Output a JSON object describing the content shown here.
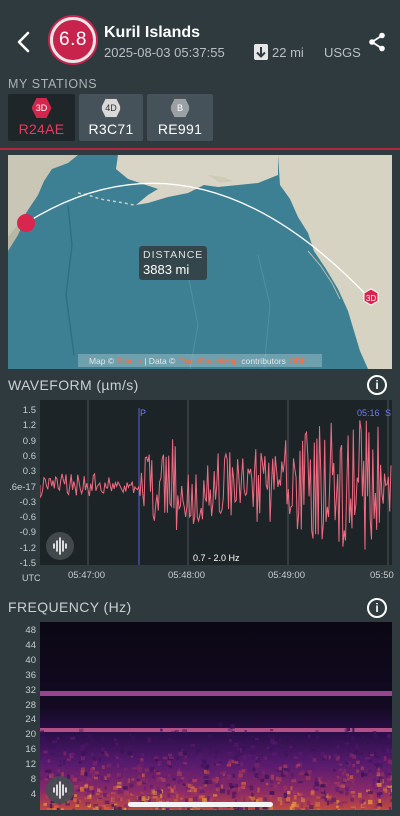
{
  "header": {
    "back_icon": "chevron-left-icon",
    "magnitude": "6.8",
    "title": "Kuril Islands",
    "datetime": "2025-08-03 05:37:55",
    "depth": "22 mi",
    "source": "USGS",
    "share_icon": "share-icon",
    "magnitude_color": "#c8234c"
  },
  "stations": {
    "label": "MY STATIONS",
    "items": [
      {
        "badge": "3D",
        "code": "R24AE",
        "selected": true
      },
      {
        "badge": "4D",
        "code": "R3C71",
        "selected": false
      },
      {
        "badge": "B",
        "code": "RE991",
        "selected": false
      }
    ],
    "accent": "#e8395f"
  },
  "map": {
    "distance_label": "DISTANCE",
    "distance_value": "3883 mi",
    "station_badge": "3D",
    "attribution": {
      "a": "Map ©",
      "b": "Stadia",
      "c": "| Data ©",
      "d": "OpenStreetMap",
      "e": "contributors",
      "f": "ODbL"
    }
  },
  "waveform": {
    "title": "WAVEFORM (µm/s)",
    "y_ticks": [
      "1.5",
      "1.2",
      "0.9",
      "0.6",
      "0.3",
      ".6e-17",
      "-0.3",
      "-0.6",
      "-0.9",
      "-1.2",
      "-1.5"
    ],
    "x_ticks": [
      "05:47:00",
      "05:48:00",
      "05:49:00",
      "05:50"
    ],
    "x_unit": "UTC",
    "filter": "0.7 - 2.0 Hz",
    "p_marker": "P",
    "s_marker": "05:16",
    "s_marker_suffix": "S",
    "trace_color": "#f06b82"
  },
  "frequency": {
    "title": "FREQUENCY (Hz)",
    "y_ticks": [
      "48",
      "44",
      "40",
      "36",
      "32",
      "28",
      "24",
      "20",
      "16",
      "12",
      "8",
      "4"
    ]
  }
}
